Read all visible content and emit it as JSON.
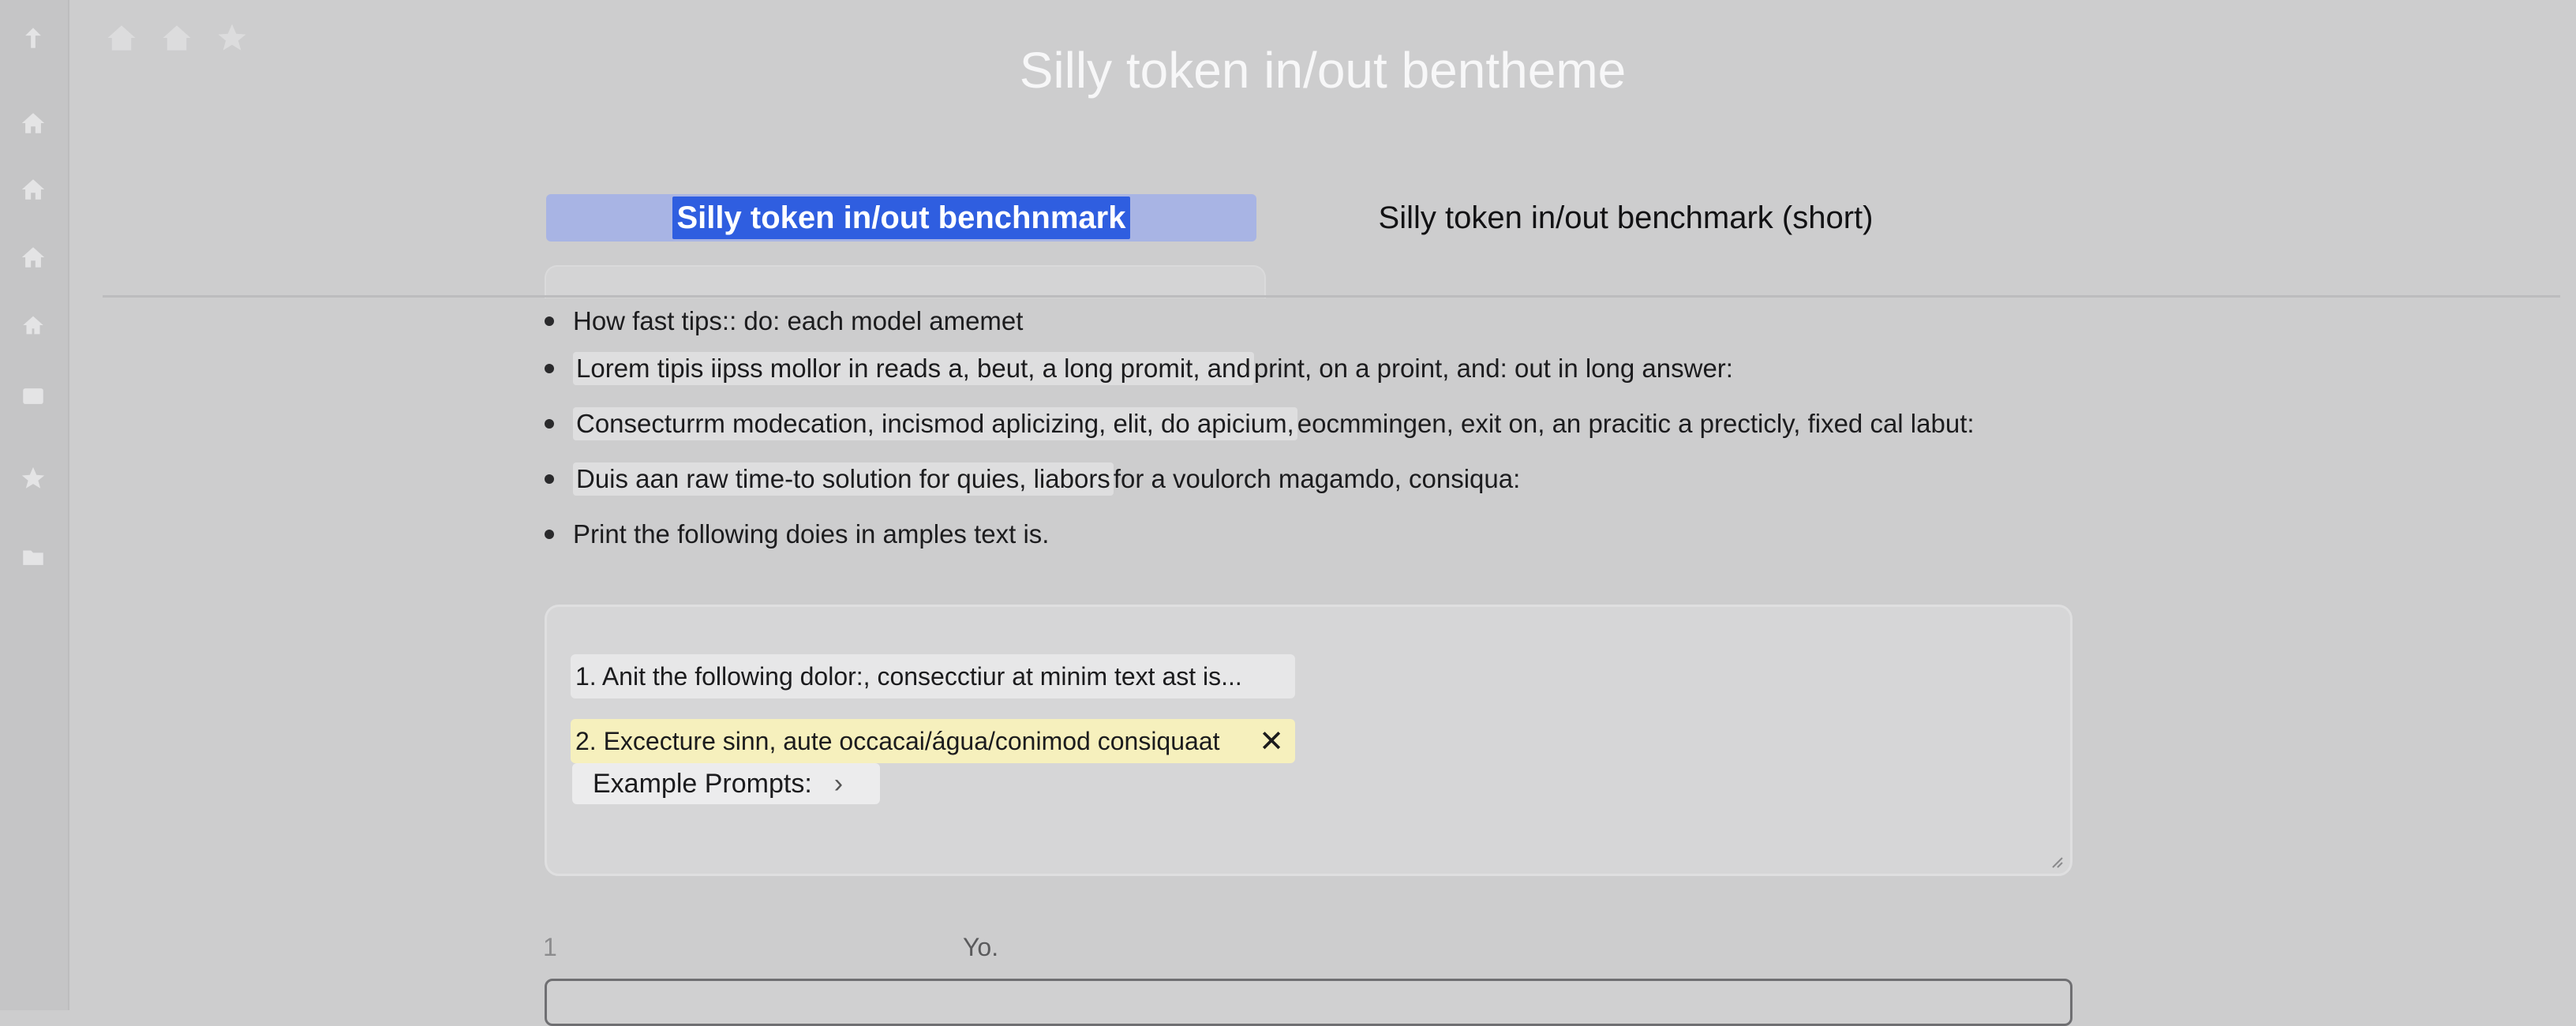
{
  "page": {
    "title": "Silly token in/out bentheme"
  },
  "tabs": [
    {
      "label": "Silly token in/out benchnmark",
      "active": true
    },
    {
      "label": "Silly token in/out benchmark (short)",
      "active": false
    }
  ],
  "bullets": [
    {
      "text": "How fast tips:: do: each model amemet",
      "highlight": "",
      "rest": ""
    },
    {
      "text": "",
      "highlight": "Lorem tipis iipss mollor in reads a, beut, a long promit, and",
      "rest": " print, on a proint, and: out in long answer:"
    },
    {
      "text": "",
      "highlight": "Consecturrm modecation, incismod aplicizing, elit, do apicium,",
      "rest": " eocmmingen, exit on, an pracitic a precticly, fixed cal labut:"
    },
    {
      "text": "",
      "highlight": "Duis aan raw time-to solution for quies, liabors",
      "rest": " for a voulorch magamdo, consiqua:"
    },
    {
      "text": "Print the following doies in amples text is.",
      "highlight": "",
      "rest": ""
    }
  ],
  "prompt_box": {
    "item_1": "1. Anit the following dolor:, consecctiur at minim text ast is...",
    "item_2": "2. Excecture sinn, aute occacai/água/conimod consiquaat",
    "item_2_close": "✕",
    "examples_label": "Example Prompts:",
    "examples_chevron": "›"
  },
  "footer": {
    "line_number": "1",
    "label": "Yo."
  },
  "icons": {
    "sidebar": [
      "arrow-up-icon",
      "home-icon",
      "home-icon",
      "home-icon",
      "home-icon",
      "window-icon",
      "star-icon",
      "folder-icon"
    ],
    "top": [
      "home-icon",
      "home-icon",
      "star-icon"
    ]
  },
  "colors": {
    "active_tab_bg": "#a8b4e4",
    "selection": "#2f5ee0",
    "highlight_yellow": "#f6f0bd"
  }
}
